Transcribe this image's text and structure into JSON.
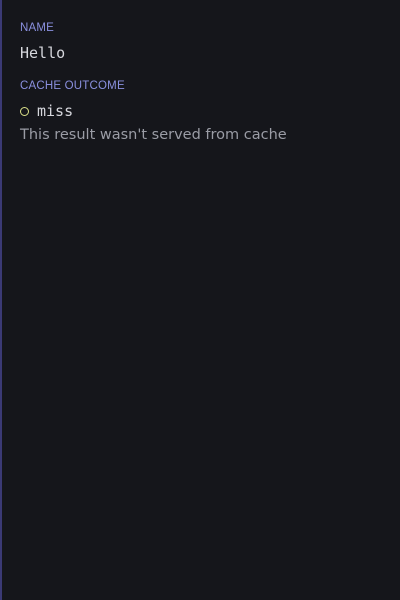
{
  "fields": {
    "name": {
      "label": "NAME",
      "value": "Hello"
    },
    "cache_outcome": {
      "label": "CACHE OUTCOME",
      "status_icon": "hollow-circle-icon",
      "status_color": "#dce28a",
      "value": "miss",
      "description": "This result wasn't served from cache"
    }
  },
  "colors": {
    "background": "#15161b",
    "label": "#8a90df",
    "accent_border": "#3b3a75"
  }
}
